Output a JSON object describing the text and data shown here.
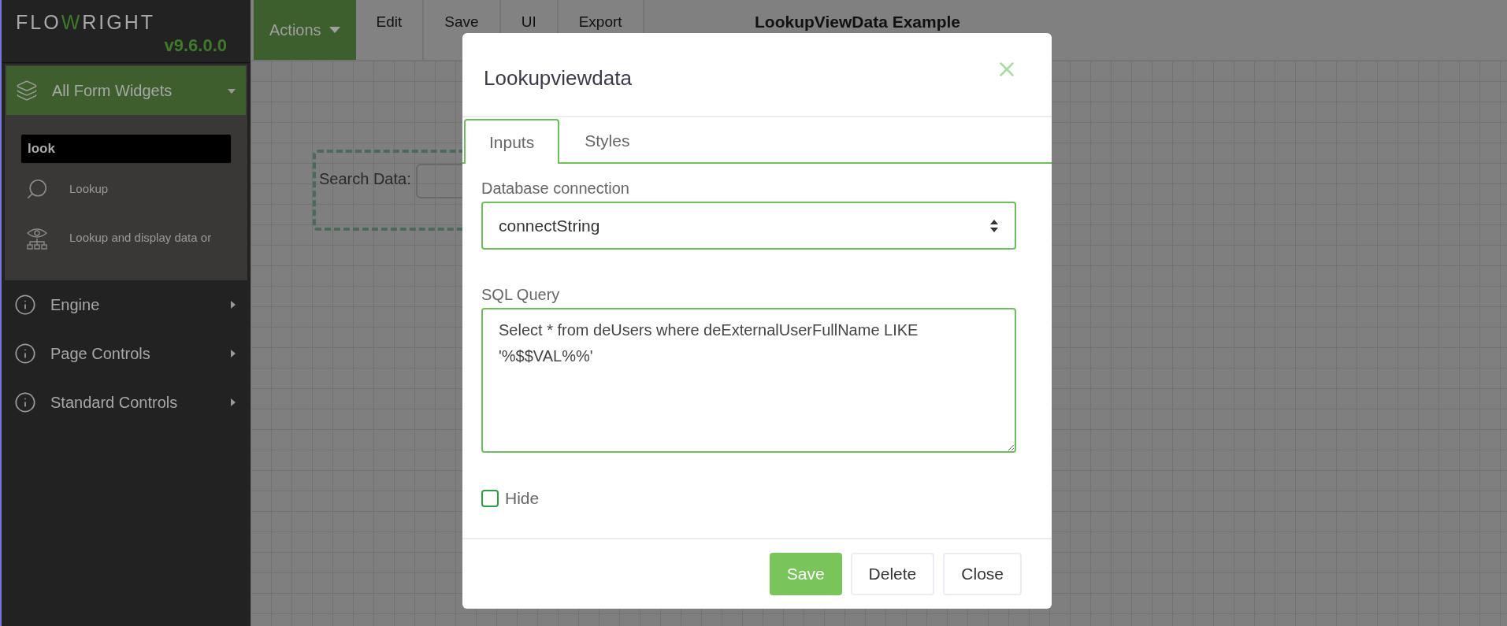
{
  "logo": {
    "parts": [
      {
        "text": "FLO",
        "color": "#a8a8a8"
      },
      {
        "text": "W",
        "color": "#3e7a2a"
      },
      {
        "text": "RIGHT",
        "color": "#a8a8a8"
      }
    ],
    "version": "v9.6.0.0"
  },
  "sidebar": {
    "sections": [
      {
        "label": "All Form Widgets",
        "expanded": true,
        "search": {
          "value": "look"
        },
        "items": [
          {
            "label": "Lookup"
          },
          {
            "label": "Lookup and display data or"
          }
        ]
      },
      {
        "label": "Engine",
        "expanded": false
      },
      {
        "label": "Page Controls",
        "expanded": false
      },
      {
        "label": "Standard Controls",
        "expanded": false
      }
    ]
  },
  "toolbar": {
    "buttons": [
      {
        "label": "Actions",
        "kind": "menu"
      },
      {
        "label": "Edit",
        "kind": "button"
      },
      {
        "label": "Save",
        "kind": "button"
      },
      {
        "label": "UI",
        "kind": "button"
      },
      {
        "label": "Export",
        "kind": "button"
      }
    ],
    "title": "LookupViewData Example"
  },
  "canvas": {
    "widget": {
      "label": "Search Data:"
    }
  },
  "modal": {
    "title": "Lookupviewdata",
    "tabs": [
      {
        "label": "Inputs",
        "selected": true
      },
      {
        "label": "Styles",
        "selected": false
      }
    ],
    "database_connection": {
      "label": "Database connection",
      "value": "connectString"
    },
    "sql_query": {
      "label": "SQL Query",
      "value": "Select * from deUsers where deExternalUserFullName LIKE '%$$VAL%%'"
    },
    "hide": {
      "label": "Hide",
      "checked": false
    },
    "buttons": [
      {
        "label": "Save",
        "kind": "primary"
      },
      {
        "label": "Delete",
        "kind": "default"
      },
      {
        "label": "Close",
        "kind": "default"
      }
    ]
  }
}
